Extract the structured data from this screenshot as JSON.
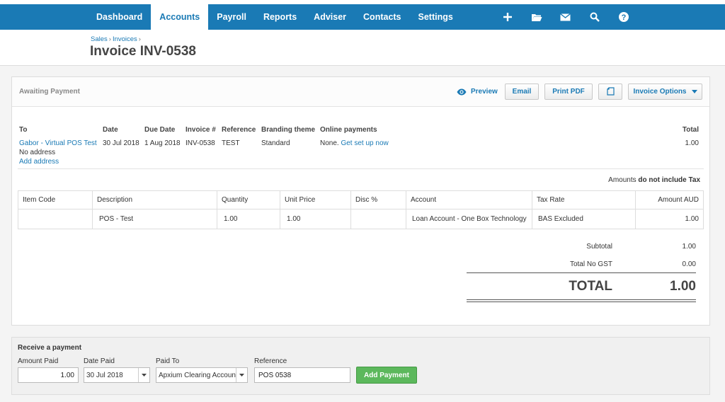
{
  "nav": {
    "tabs": [
      "Dashboard",
      "Accounts",
      "Payroll",
      "Reports",
      "Adviser",
      "Contacts",
      "Settings"
    ],
    "active": 1,
    "icons": [
      "plus-icon",
      "folder-icon",
      "mail-icon",
      "search-icon",
      "help-icon"
    ]
  },
  "breadcrumb": [
    "Sales",
    "Invoices"
  ],
  "title": "Invoice INV-0538",
  "status": "Awaiting Payment",
  "actions": {
    "preview": "Preview",
    "email": "Email",
    "print": "Print PDF",
    "options": "Invoice Options"
  },
  "invoice": {
    "to_label": "To",
    "to": "Gabor - Virtual POS Test",
    "address": "No address",
    "add_address": "Add address",
    "date_label": "Date",
    "date": "30 Jul 2018",
    "due_label": "Due Date",
    "due": "1 Aug 2018",
    "number_label": "Invoice #",
    "number": "INV-0538",
    "ref_label": "Reference",
    "ref": "TEST",
    "brand_label": "Branding theme",
    "brand": "Standard",
    "online_label": "Online payments",
    "online": "None.",
    "online_link": "Get set up now",
    "total_label": "Total",
    "total": "1.00"
  },
  "amounts_note": {
    "prefix": "Amounts",
    "bold": "do not include Tax"
  },
  "columns": [
    "Item Code",
    "Description",
    "Quantity",
    "Unit Price",
    "Disc %",
    "Account",
    "Tax Rate",
    "Amount AUD"
  ],
  "rows": [
    {
      "code": "",
      "desc": "POS - Test",
      "qty": "1.00",
      "price": "1.00",
      "disc": "",
      "account": "Loan Account - One Box Technology",
      "tax": "BAS Excluded",
      "amount": "1.00"
    }
  ],
  "totals": {
    "subtotal_label": "Subtotal",
    "subtotal": "1.00",
    "gst_label": "Total No GST",
    "gst": "0.00",
    "total_label": "TOTAL",
    "total": "1.00"
  },
  "payment": {
    "heading": "Receive a payment",
    "amount_label": "Amount Paid",
    "amount": "1.00",
    "date_label": "Date Paid",
    "date": "30 Jul 2018",
    "paidto_label": "Paid To",
    "paidto": "Apxium Clearing Account",
    "ref_label": "Reference",
    "ref": "POS 0538",
    "button": "Add Payment"
  },
  "colors": {
    "nav": "#1a7ab5",
    "link": "#1a7ab5",
    "button_green": "#5cb85c"
  }
}
